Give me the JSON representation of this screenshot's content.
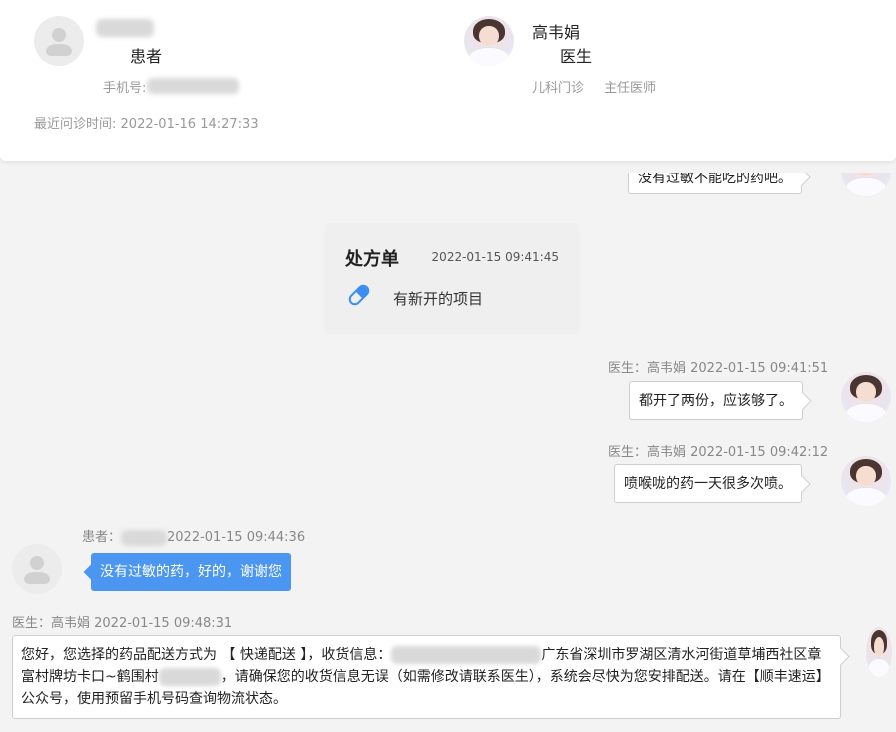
{
  "header": {
    "patient": {
      "role_label": "患者",
      "phone_label": "手机号:",
      "last_visit_label": "最近问诊时间:",
      "last_visit_time": "2022-01-16 14:27:33"
    },
    "doctor": {
      "name": "高韦娟",
      "role_label": "医生",
      "department": "儿科门诊",
      "title": "主任医师"
    }
  },
  "messages": {
    "partial": {
      "text": "没有过敏不能吃的药吧。"
    },
    "prescription": {
      "title": "处方单",
      "time": "2022-01-15 09:41:45",
      "text": "有新开的项目",
      "icon": "pill-icon"
    },
    "doc1": {
      "meta": "医生：高韦娟 2022-01-15 09:41:51",
      "text": "都开了两份，应该够了。"
    },
    "doc2": {
      "meta": "医生：高韦娟 2022-01-15 09:42:12",
      "text": "喷喉咙的药一天很多次喷。"
    },
    "patient1": {
      "meta_prefix": "患者：",
      "time": "2022-01-15 09:44:36",
      "text": "没有过敏的药，好的，谢谢您"
    },
    "doc3": {
      "meta": "医生：高韦娟 2022-01-15 09:48:31",
      "part1": "您好，您选择的药品配送方式为 【 快递配送 】，收货信息：",
      "part2": "广东省深圳市罗湖区清水河街道草埔西社区章富村牌坊卡口~鹤围村",
      "part3": "，请确保您的收货信息无误（如需修改请联系医生），系统会尽快为您安排配送。请在【顺丰速运】公众号，使用预留手机号码查询物流状态。"
    }
  }
}
